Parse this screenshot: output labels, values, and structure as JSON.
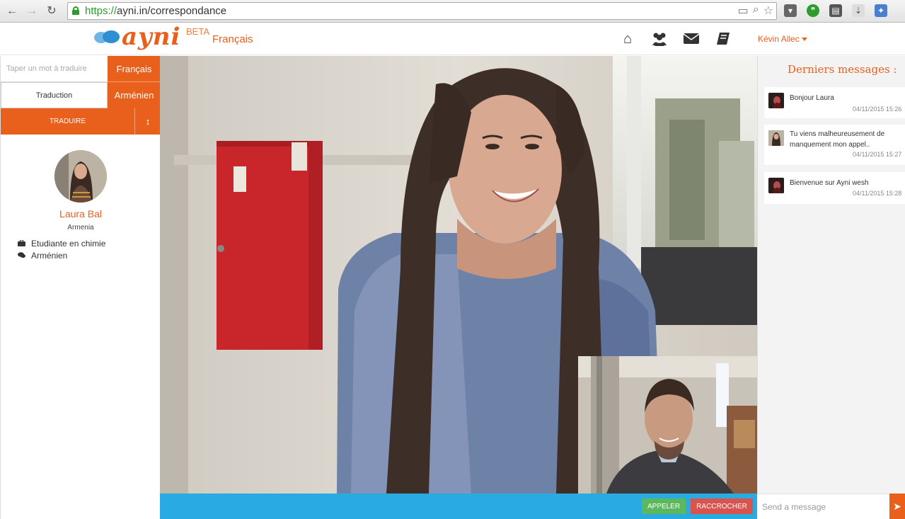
{
  "browser": {
    "url_scheme": "https://",
    "url_rest": "ayni.in/correspondance",
    "nav": {
      "back_icon": "back-arrow-icon",
      "forward_icon": "forward-arrow-icon",
      "reload_icon": "reload-icon"
    }
  },
  "header": {
    "logo_text": "ayni",
    "beta_label": "BETA",
    "language": "Français",
    "icons": [
      "home-icon",
      "users-icon",
      "mail-icon",
      "book-icon"
    ],
    "user_name": "Kévin Allec"
  },
  "sidebar": {
    "word_input_placeholder": "Taper un mot à traduire",
    "source_language": "Français",
    "translation_label": "Traduction",
    "target_language": "Arménien",
    "translate_button": "TRADUIRE",
    "swap_symbol": "↕",
    "profile": {
      "name": "Laura Bal",
      "country": "Armenia",
      "occupation": "Etudiante en chimie",
      "language": "Arménien"
    }
  },
  "call": {
    "call_button": "APPELER",
    "hangup_button": "RACCROCHER"
  },
  "messages": {
    "title": "Derniers messages :",
    "items": [
      {
        "text": "Bonjour Laura",
        "time": "04/11/2015 15:26"
      },
      {
        "text": "Tu viens malheureusement de manquement mon appel..",
        "time": "04/11/2015 15:27"
      },
      {
        "text": "Bienvenue sur Ayni wesh",
        "time": "04/11/2015 15:28"
      }
    ],
    "input_placeholder": "Send a message"
  },
  "colors": {
    "brand": "#e8601c",
    "call_bar": "#29abe2",
    "call_green": "#5cb85c",
    "hangup_red": "#d9534f"
  }
}
